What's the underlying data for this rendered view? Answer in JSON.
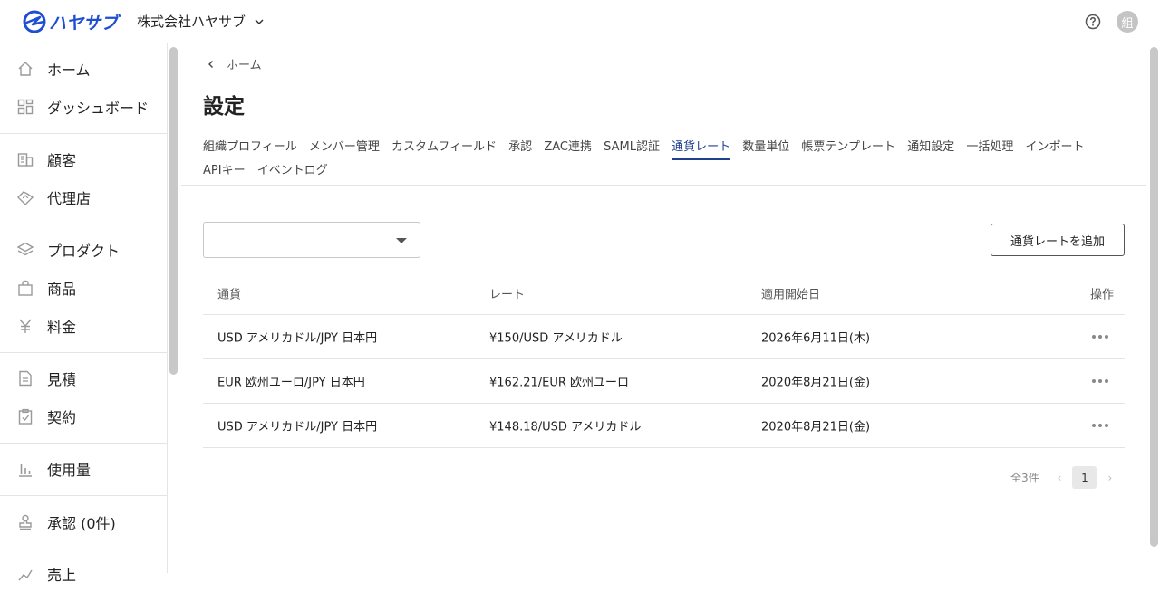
{
  "app": {
    "logo_text": "ハヤサブ",
    "company_name": "株式会社ハヤサブ",
    "avatar_initial": "組"
  },
  "sidebar": {
    "items": [
      {
        "label": "ホーム",
        "icon": "home-icon"
      },
      {
        "label": "ダッシュボード",
        "icon": "dashboard-icon"
      },
      {
        "label": "顧客",
        "icon": "building-icon"
      },
      {
        "label": "代理店",
        "icon": "handshake-icon"
      },
      {
        "label": "プロダクト",
        "icon": "layers-icon"
      },
      {
        "label": "商品",
        "icon": "bag-icon"
      },
      {
        "label": "料金",
        "icon": "yen-icon"
      },
      {
        "label": "見積",
        "icon": "document-icon"
      },
      {
        "label": "契約",
        "icon": "clipboard-check-icon"
      },
      {
        "label": "使用量",
        "icon": "bar-chart-icon"
      },
      {
        "label": "承認 (0件)",
        "icon": "stamp-icon"
      },
      {
        "label": "売上",
        "icon": "sales-icon"
      }
    ]
  },
  "breadcrumb": {
    "home": "ホーム"
  },
  "page": {
    "title": "設定"
  },
  "tabs": [
    {
      "label": "組織プロフィール",
      "active": false
    },
    {
      "label": "メンバー管理",
      "active": false
    },
    {
      "label": "カスタムフィールド",
      "active": false
    },
    {
      "label": "承認",
      "active": false
    },
    {
      "label": "ZAC連携",
      "active": false
    },
    {
      "label": "SAML認証",
      "active": false
    },
    {
      "label": "通貨レート",
      "active": true
    },
    {
      "label": "数量単位",
      "active": false
    },
    {
      "label": "帳票テンプレート",
      "active": false
    },
    {
      "label": "通知設定",
      "active": false
    },
    {
      "label": "一括処理",
      "active": false
    },
    {
      "label": "インポート",
      "active": false
    },
    {
      "label": "APIキー",
      "active": false
    },
    {
      "label": "イベントログ",
      "active": false
    }
  ],
  "filter": {
    "selected": ""
  },
  "actions": {
    "add_label": "通貨レートを追加"
  },
  "table": {
    "headers": [
      "通貨",
      "レート",
      "適用開始日",
      "操作"
    ],
    "rows": [
      {
        "currency": "USD アメリカドル/JPY 日本円",
        "rate": "¥150/USD アメリカドル",
        "start_date": "2026年6月11日(木)"
      },
      {
        "currency": "EUR 欧州ユーロ/JPY 日本円",
        "rate": "¥162.21/EUR 欧州ユーロ",
        "start_date": "2020年8月21日(金)"
      },
      {
        "currency": "USD アメリカドル/JPY 日本円",
        "rate": "¥148.18/USD アメリカドル",
        "start_date": "2020年8月21日(金)"
      }
    ]
  },
  "pagination": {
    "total": "全3件",
    "current_page": "1"
  },
  "colors": {
    "brand": "#1f4fd1",
    "active_tab": "#1f3f8f"
  }
}
